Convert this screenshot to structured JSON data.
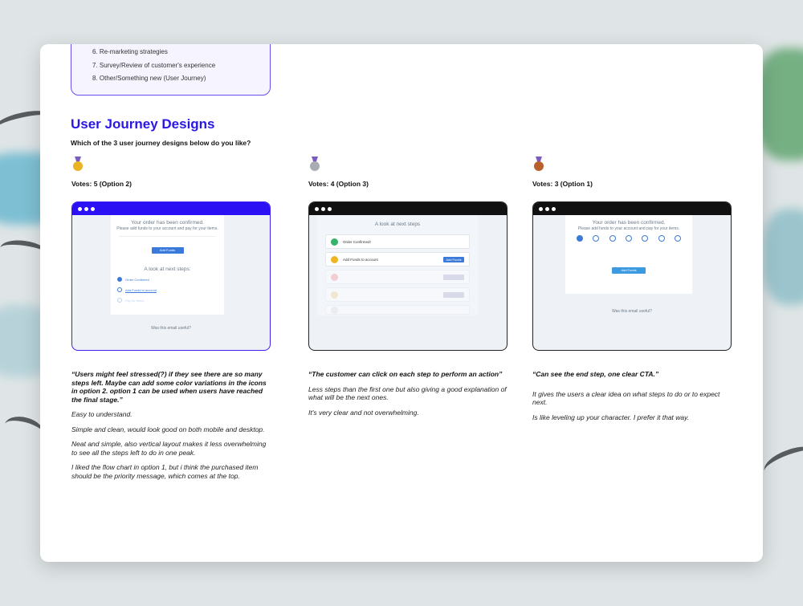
{
  "toc": {
    "items": [
      "6. Re-marketing strategies",
      "7. Survey/Review of customer's experience",
      "8. Other/Something new (User Journey)"
    ]
  },
  "section": {
    "title": "User Journey Designs",
    "question": "Which of the 3 user journey designs below do you like?"
  },
  "options": [
    {
      "medal": "gold-medal-icon",
      "votes": "Votes: 5 (Option 2)",
      "mock": {
        "title": "Your order has been confirmed.",
        "subtitle": "Please add funds to your account and pay for your items.",
        "button": "Add Funds",
        "steps_title": "A look at next steps:",
        "step1": "Order Confirmed",
        "step2": "Add Funds to account",
        "step3": "Pay for items",
        "footer": "Was this email useful?"
      },
      "quote": "“Users might feel stressed(?) if they see there are so many steps left. Maybe can add some color variations in the icons in option 2. option 1 can be used when users have reached the final stage.”",
      "comments": [
        "Easy to understand.",
        "Simple and clean, would look good on both mobile and desktop.",
        "Neat and simple, also vertical layout makes it less overwhelming to see all the steps left to do in one peak.",
        "I liked the flow chart in option 1, but i think the purchased item should be the priority message, which comes at the top."
      ]
    },
    {
      "medal": "silver-medal-icon",
      "votes": "Votes: 4 (Option 3)",
      "mock": {
        "title": "A look at next steps",
        "row1": "Order Confirmed!",
        "row2": "Add Funds to account",
        "button": "Add Funds"
      },
      "quote": "“The customer can click on each step to perform an action”",
      "comments": [
        "Less steps than the first one but also giving a good explanation of what will be the next ones.",
        "It's very clear and not overwhelming."
      ]
    },
    {
      "medal": "bronze-medal-icon",
      "votes": "Votes: 3 (Option 1)",
      "mock": {
        "title": "Your order has been confirmed.",
        "subtitle": "Please add funds to your account and pay for your items.",
        "button": "Add Funds",
        "footer": "Was this email useful?"
      },
      "quote": "“Can see the end step, one clear CTA.”",
      "comments": [
        "It gives the users a clear idea on what steps to do or to expect next.",
        "Is like leveling up your character. I prefer it that way."
      ]
    }
  ],
  "colors": {
    "accent": "#2a17e6",
    "gold": "#e9b321",
    "silver": "#a9adb3",
    "bronze": "#b8612a"
  }
}
